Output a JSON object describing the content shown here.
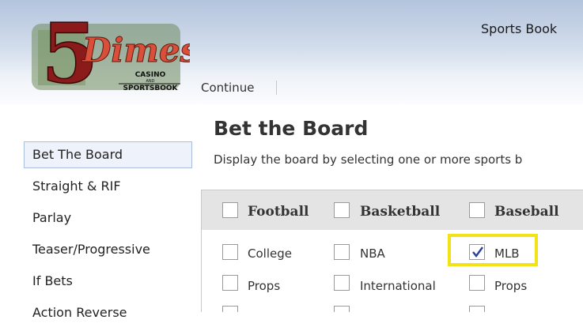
{
  "header": {
    "logo": {
      "brand_text": "5Dimes",
      "sub_line_1": "CASINO",
      "sub_line_2": "AND",
      "sub_line_3": "SPORTSBOOK",
      "number_color": "#8b1a1a",
      "brand_color": "#d94f3a"
    },
    "top_nav_label": "Sports Book",
    "continue_label": "Continue"
  },
  "sidebar": {
    "items": [
      {
        "label": "Bet The Board",
        "active": true
      },
      {
        "label": "Straight & RIF",
        "active": false
      },
      {
        "label": "Parlay",
        "active": false
      },
      {
        "label": "Teaser/Progressive",
        "active": false
      },
      {
        "label": "If Bets",
        "active": false
      },
      {
        "label": "Action Reverse",
        "active": false
      }
    ]
  },
  "main": {
    "title": "Bet the Board",
    "description": "Display the board by selecting one or more sports b",
    "columns": [
      {
        "label": "Football",
        "checked": false,
        "options": [
          {
            "label": "College",
            "checked": false
          },
          {
            "label": "Props",
            "checked": false
          }
        ]
      },
      {
        "label": "Basketball",
        "checked": false,
        "options": [
          {
            "label": "NBA",
            "checked": false
          },
          {
            "label": "International",
            "checked": false
          }
        ]
      },
      {
        "label": "Baseball",
        "checked": false,
        "options": [
          {
            "label": "MLB",
            "checked": true
          },
          {
            "label": "Props",
            "checked": false
          }
        ]
      }
    ],
    "highlight_color": "#f2e316"
  }
}
